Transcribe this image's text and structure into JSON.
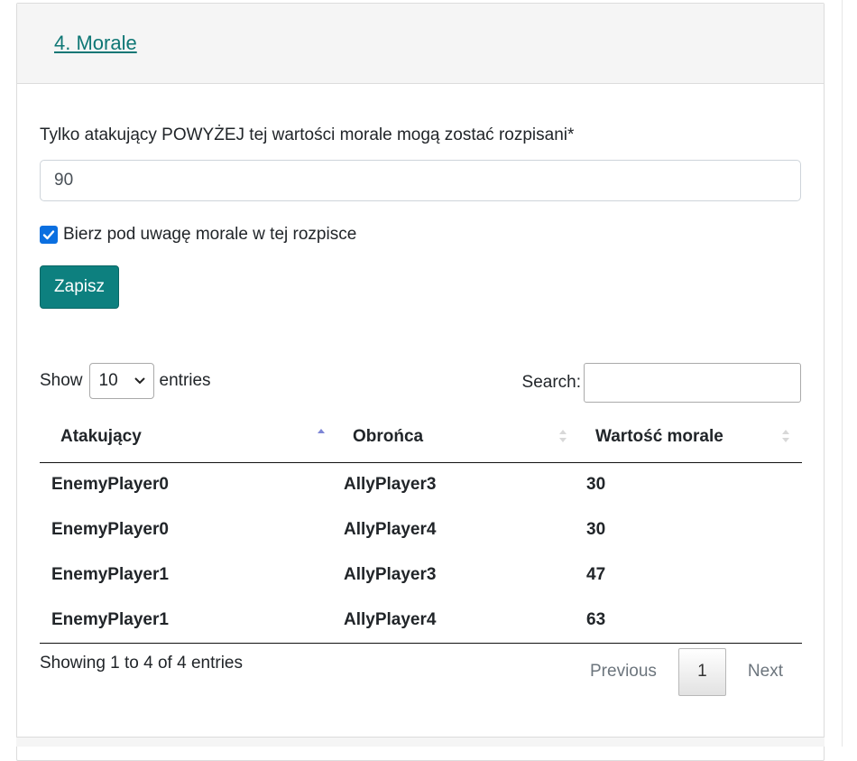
{
  "header": {
    "section_title": "4. Morale"
  },
  "form": {
    "label": "Tylko atakujący POWYŻEJ tej wartości morale mogą zostać rozpisani*",
    "value": "90",
    "checkbox_label": "Bierz pod uwagę morale w tej rozpisce",
    "checkbox_checked": true,
    "save_label": "Zapisz"
  },
  "table_controls": {
    "show_label": "Show",
    "page_size": "10",
    "entries_label": "entries",
    "search_label": "Search:"
  },
  "table": {
    "columns": [
      "Atakujący",
      "Obrońca",
      "Wartość morale"
    ],
    "sorted_column": "Atakujący",
    "sort_direction": "ascending",
    "rows": [
      [
        "EnemyPlayer0",
        "AllyPlayer3",
        "30"
      ],
      [
        "EnemyPlayer0",
        "AllyPlayer4",
        "30"
      ],
      [
        "EnemyPlayer1",
        "AllyPlayer3",
        "47"
      ],
      [
        "EnemyPlayer1",
        "AllyPlayer4",
        "63"
      ]
    ]
  },
  "footer": {
    "info": "Showing 1 to 4 of 4 entries",
    "previous": "Previous",
    "current_page": "1",
    "next": "Next"
  },
  "colors": {
    "accent": "#0d807f",
    "link": "#0f7775",
    "checkbox": "#0b6fe0"
  }
}
